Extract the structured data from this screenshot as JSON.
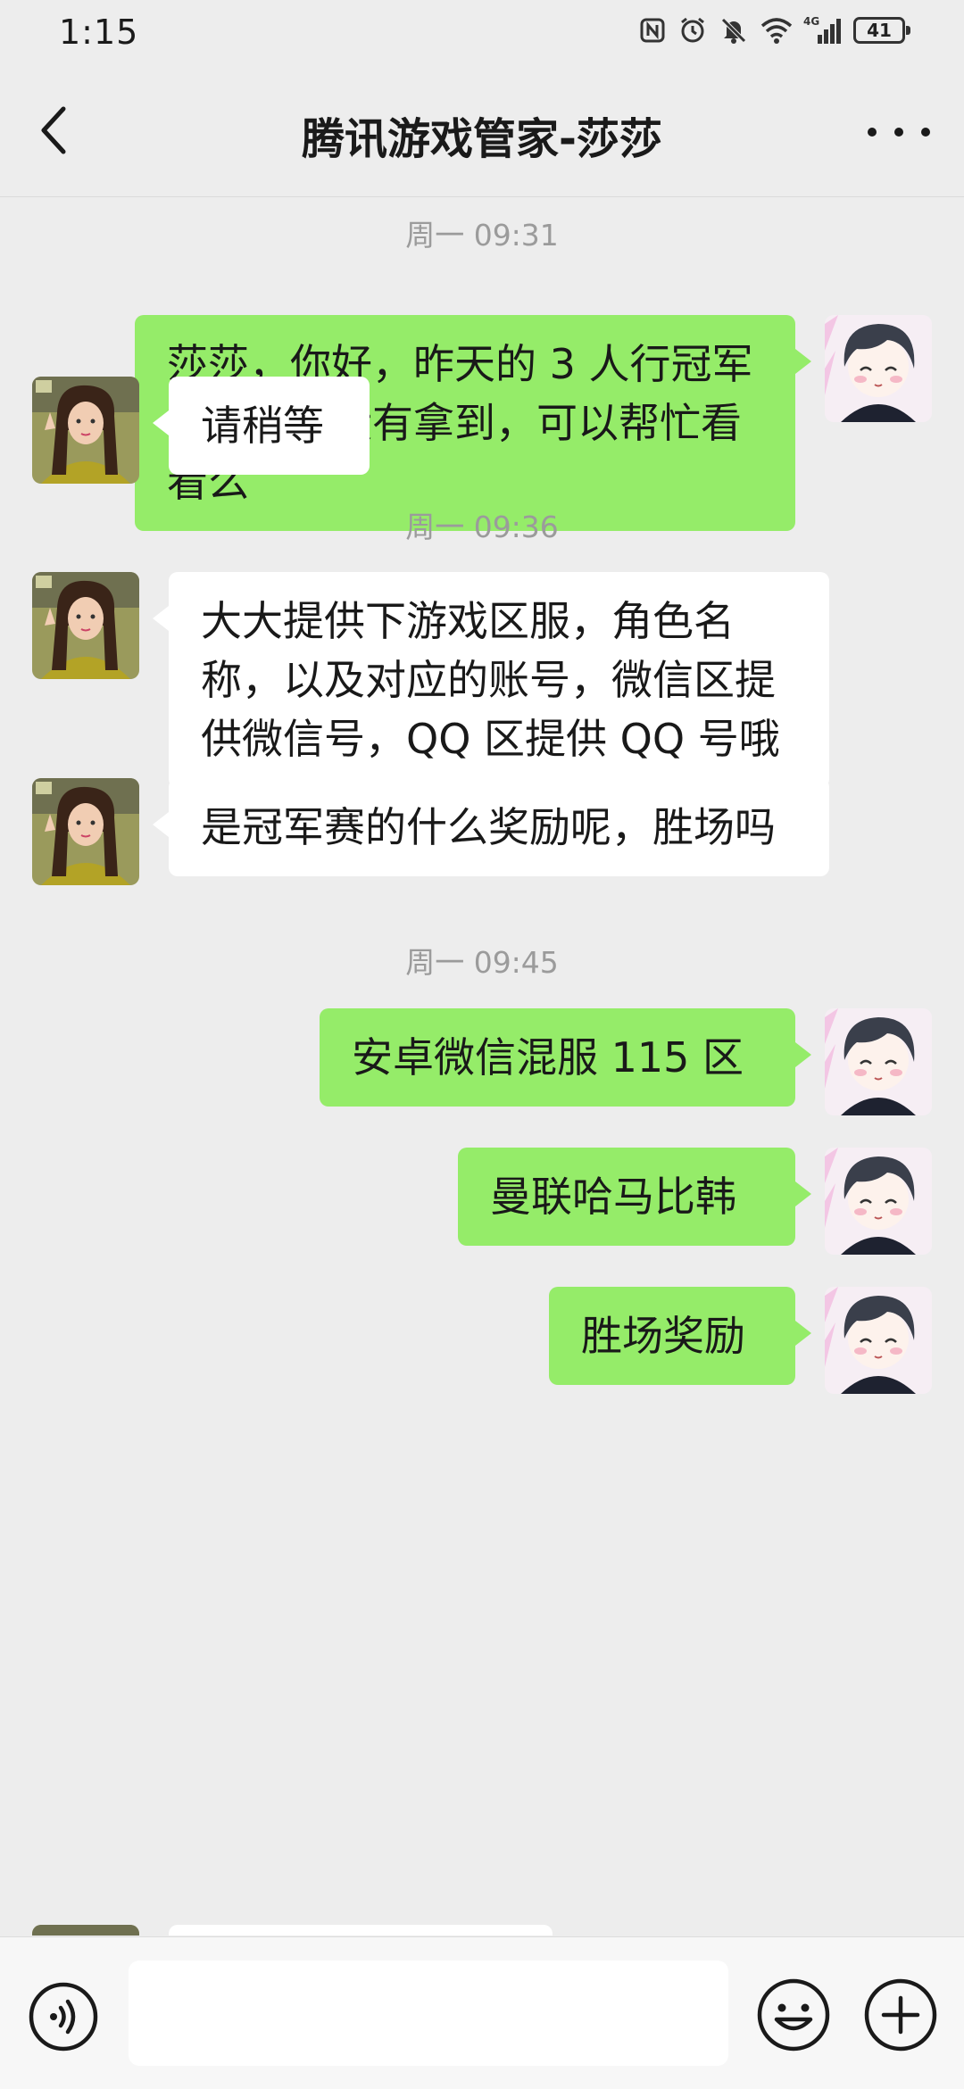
{
  "status_bar": {
    "time": "1:15",
    "network": "4G",
    "battery": "41",
    "icons": [
      "nfc-icon",
      "alarm-icon",
      "mute-icon",
      "wifi-icon",
      "signal-icon",
      "battery-icon"
    ]
  },
  "header": {
    "title": "腾讯游戏管家-莎莎",
    "back_icon": "chevron-left-icon",
    "more_icon": "more-dots-icon"
  },
  "messages": [
    {
      "type": "timestamp",
      "text": "周一 09:31"
    },
    {
      "type": "message",
      "side": "sent",
      "text": "莎莎，你好，昨天的 3 人行冠军赛的奖励没有拿到，可以帮忙看看么"
    },
    {
      "type": "message",
      "side": "received",
      "text": "请稍等"
    },
    {
      "type": "timestamp",
      "text": "周一 09:36"
    },
    {
      "type": "message",
      "side": "received",
      "text": "大大提供下游戏区服，角色名称，以及对应的账号，微信区提供微信号，QQ 区提供 QQ 号哦"
    },
    {
      "type": "message",
      "side": "received",
      "text": "是冠军赛的什么奖励呢，胜场吗"
    },
    {
      "type": "timestamp",
      "text": "周一 09:45"
    },
    {
      "type": "message",
      "side": "sent",
      "text": "安卓微信混服 115 区"
    },
    {
      "type": "message",
      "side": "sent",
      "text": "曼联哈马比韩"
    },
    {
      "type": "message",
      "side": "sent",
      "text": "胜场奖励"
    }
  ],
  "input_bar": {
    "voice_icon": "voice-icon",
    "emoji_icon": "emoji-icon",
    "plus_icon": "plus-icon",
    "input_value": ""
  },
  "colors": {
    "background": "#ededed",
    "sent_bubble": "#95ec69",
    "received_bubble": "#ffffff",
    "timestamp_text": "#9b9b9b"
  }
}
